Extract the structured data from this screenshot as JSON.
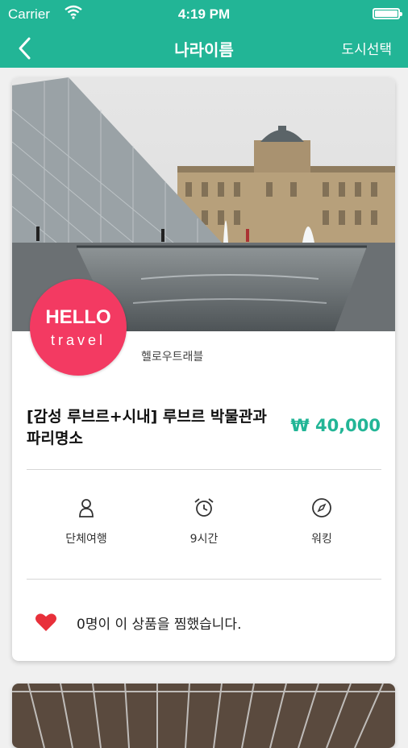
{
  "status_bar": {
    "carrier": "Carrier",
    "time": "4:19 PM"
  },
  "nav": {
    "title": "나라이름",
    "right_label": "도시선택"
  },
  "product": {
    "provider_logo_line1": "HELLO",
    "provider_logo_line2": "travel",
    "provider_name": "헬로우트래블",
    "title": "[감성 루브르+시내] 루브르 박물관과 파리명소",
    "price": "₩ 40,000",
    "features": [
      {
        "icon": "person-icon",
        "label": "단체여행"
      },
      {
        "icon": "alarm-clock-icon",
        "label": "9시간"
      },
      {
        "icon": "compass-icon",
        "label": "워킹"
      }
    ],
    "like_text": "0명이 이 상품을 찜했습니다."
  },
  "colors": {
    "accent": "#22b596",
    "logo_bg": "#f33a62",
    "heart": "#e8303a"
  }
}
